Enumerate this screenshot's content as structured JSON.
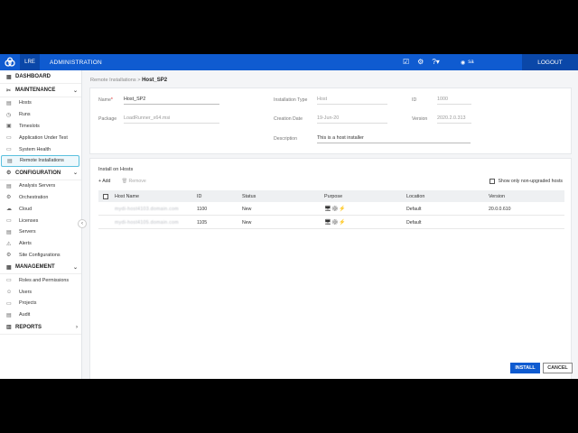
{
  "topbar": {
    "product": "LRE",
    "section": "ADMINISTRATION",
    "user": "sa",
    "logout": "LOGOUT"
  },
  "sidebar": {
    "dashboard": "DASHBOARD",
    "maintenance": {
      "label": "MAINTENANCE",
      "items": [
        "Hosts",
        "Runs",
        "Timeslots",
        "Application Under Test",
        "System Health",
        "Remote Installations"
      ]
    },
    "configuration": {
      "label": "CONFIGURATION",
      "items": [
        "Analysis Servers",
        "Orchestration",
        "Cloud",
        "Licenses",
        "Servers",
        "Alerts",
        "Site Configurations"
      ]
    },
    "management": {
      "label": "MANAGEMENT",
      "items": [
        "Roles and Permissions",
        "Users",
        "Projects",
        "Audit"
      ]
    },
    "reports": "REPORTS"
  },
  "breadcrumb": {
    "parent": "Remote Installations",
    "separator": ">",
    "current": "Host_SP2"
  },
  "details": {
    "name_label": "Name",
    "name_value": "Host_SP2",
    "package_label": "Package",
    "package_value": "LoadRunner_x64.msi",
    "install_type_label": "Installation Type",
    "install_type_value": "Host",
    "creation_date_label": "Creation Date",
    "creation_date_value": "19-Jun-20",
    "description_label": "Description",
    "description_value": "This is a host installer",
    "id_label": "ID",
    "id_value": "1000",
    "version_label": "Version",
    "version_value": "2020.2.0.313"
  },
  "hosts": {
    "title": "Install on Hosts",
    "add": "Add",
    "remove": "Remove",
    "only_non_upgraded": "Show only non-upgraded hosts",
    "columns": [
      "Host Name",
      "ID",
      "Status",
      "Purpose",
      "Location",
      "Version"
    ],
    "rows": [
      {
        "host": "mydi-host4103.domain.com",
        "id": "1100",
        "status": "New",
        "purpose": "🖥⚙⚡",
        "location": "Default",
        "version": "20.0.0.610"
      },
      {
        "host": "mydi-host4105.domain.com",
        "id": "1105",
        "status": "New",
        "purpose": "🖥⚙⚡",
        "location": "Default",
        "version": ""
      }
    ]
  },
  "footer": {
    "install": "INSTALL",
    "cancel": "CANCEL"
  }
}
